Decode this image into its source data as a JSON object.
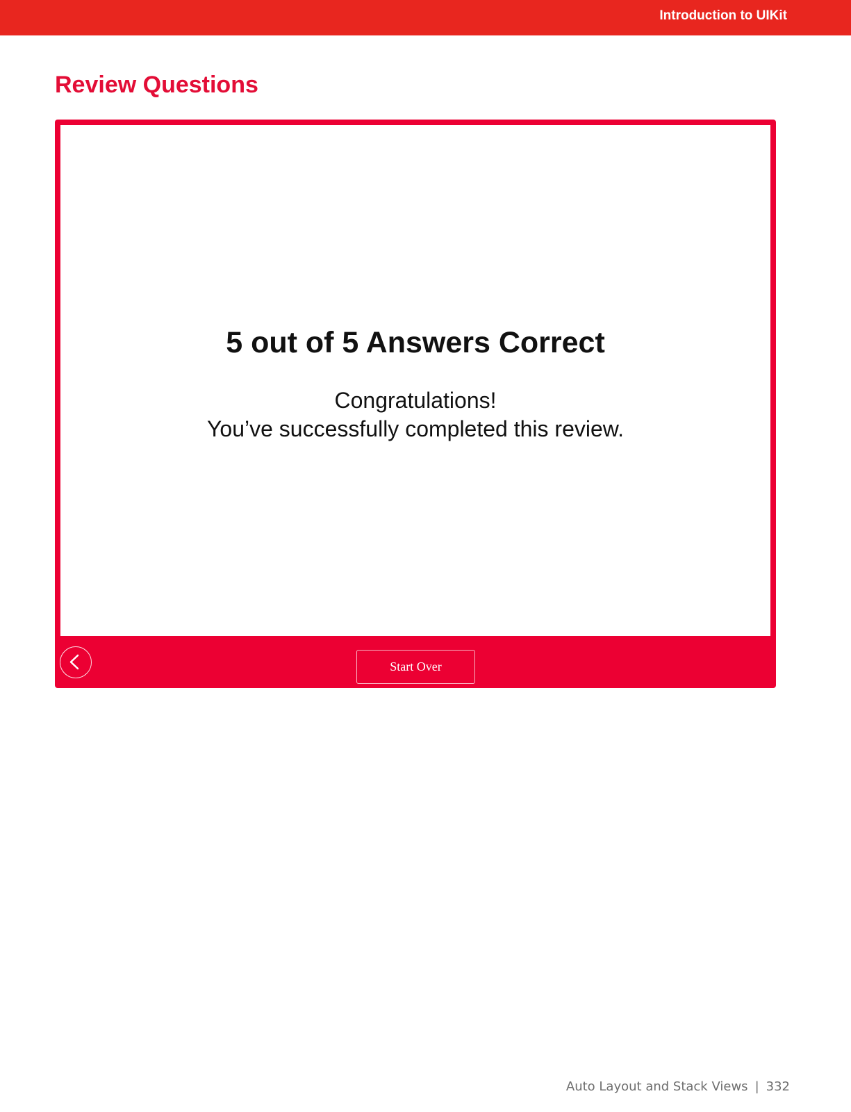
{
  "header": {
    "title": "Introduction to UIKit"
  },
  "section": {
    "heading": "Review Questions"
  },
  "quiz": {
    "score_title": "5 out of 5 Answers Correct",
    "message_line1": "Congratulations!",
    "message_line2": "You’ve successfully completed this review.",
    "start_over_label": "Start Over",
    "back_icon": "chevron-left-icon"
  },
  "footer": {
    "chapter": "Auto Layout and Stack Views",
    "separator": "|",
    "page_number": "332"
  },
  "colors": {
    "header_bar": "#e8261f",
    "accent": "#ec0033",
    "heading": "#e30d36"
  }
}
